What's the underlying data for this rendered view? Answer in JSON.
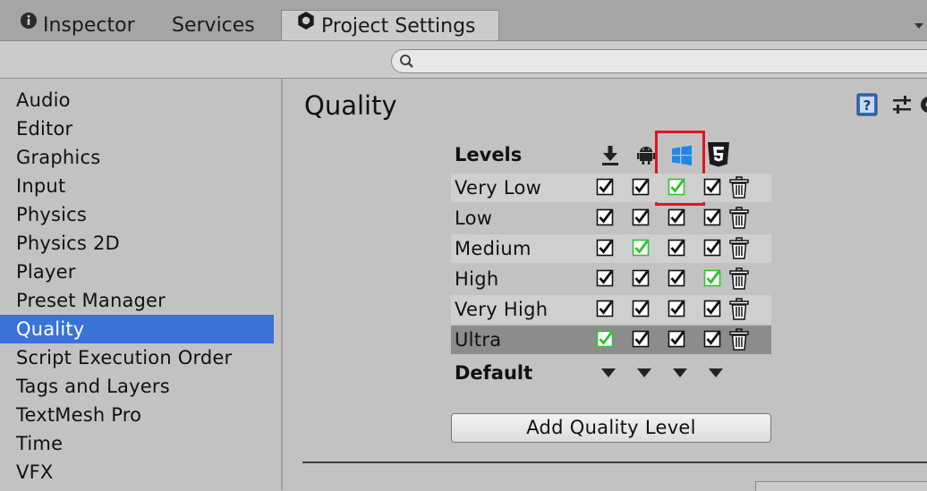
{
  "tabs": [
    {
      "label": "Inspector",
      "icon": "info-icon"
    },
    {
      "label": "Services"
    },
    {
      "label": "Project Settings",
      "icon": "gear-icon",
      "active": true
    }
  ],
  "search": {
    "placeholder": ""
  },
  "sidebar": {
    "items": [
      {
        "label": "Audio"
      },
      {
        "label": "Editor"
      },
      {
        "label": "Graphics"
      },
      {
        "label": "Input"
      },
      {
        "label": "Physics"
      },
      {
        "label": "Physics 2D"
      },
      {
        "label": "Player"
      },
      {
        "label": "Preset Manager"
      },
      {
        "label": "Quality",
        "selected": true
      },
      {
        "label": "Script Execution Order"
      },
      {
        "label": "Tags and Layers"
      },
      {
        "label": "TextMesh Pro"
      },
      {
        "label": "Time"
      },
      {
        "label": "VFX"
      }
    ]
  },
  "main": {
    "title": "Quality",
    "levels_label": "Levels",
    "platforms": [
      "standalone-download-icon",
      "android-icon",
      "windows-icon",
      "html5-icon"
    ],
    "levels": [
      {
        "name": "Very Low",
        "checks": [
          true,
          true,
          true,
          true
        ],
        "default_for": [
          2
        ]
      },
      {
        "name": "Low",
        "checks": [
          true,
          true,
          true,
          true
        ],
        "default_for": []
      },
      {
        "name": "Medium",
        "checks": [
          true,
          true,
          true,
          true
        ],
        "default_for": [
          1
        ]
      },
      {
        "name": "High",
        "checks": [
          true,
          true,
          true,
          true
        ],
        "default_for": [
          3
        ]
      },
      {
        "name": "Very High",
        "checks": [
          true,
          true,
          true,
          true
        ],
        "default_for": []
      },
      {
        "name": "Ultra",
        "checks": [
          true,
          true,
          true,
          true
        ],
        "default_for": [
          0
        ],
        "selected": true
      }
    ],
    "default_label": "Default",
    "add_button_label": "Add Quality Level"
  },
  "colors": {
    "selection": "#3a72d8",
    "default_check": "#2ec22e",
    "highlight_box": "#e0151f",
    "windows_blue": "#1e88e5"
  }
}
